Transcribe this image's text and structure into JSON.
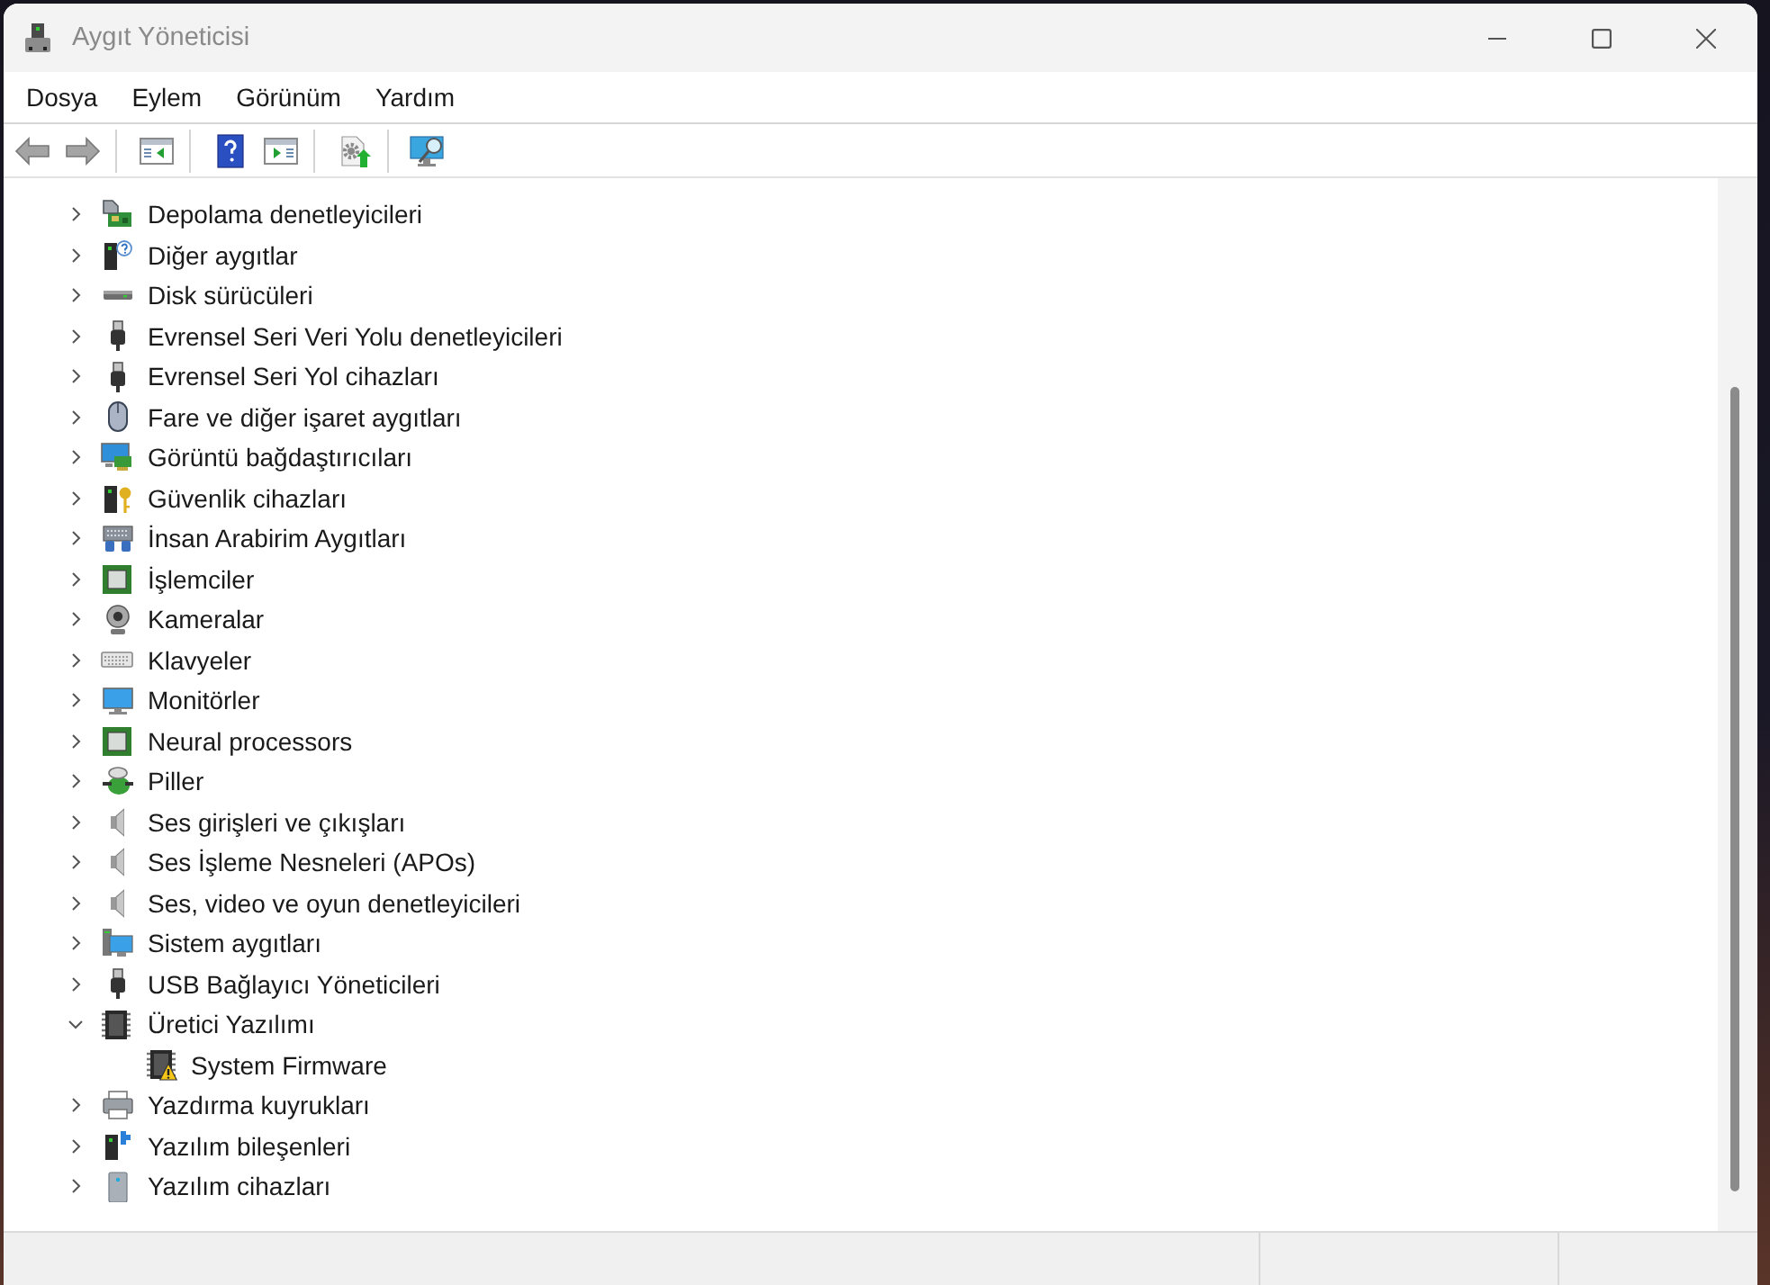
{
  "window": {
    "title": "Aygıt Yöneticisi"
  },
  "menu": [
    "Dosya",
    "Eylem",
    "Görünüm",
    "Yardım"
  ],
  "toolbar": {
    "back": {
      "disabled": true
    },
    "forward": {
      "disabled": true
    }
  },
  "tree": [
    {
      "label": "Depolama denetleyicileri",
      "kind": "storage",
      "expanded": false
    },
    {
      "label": "Diğer aygıtlar",
      "kind": "unknown",
      "expanded": false
    },
    {
      "label": "Disk sürücüleri",
      "kind": "disk",
      "expanded": false
    },
    {
      "label": "Evrensel Seri Veri Yolu denetleyicileri",
      "kind": "usb",
      "expanded": false
    },
    {
      "label": "Evrensel Seri Yol cihazları",
      "kind": "usb",
      "expanded": false
    },
    {
      "label": "Fare ve diğer işaret aygıtları",
      "kind": "mouse",
      "expanded": false
    },
    {
      "label": "Görüntü bağdaştırıcıları",
      "kind": "display",
      "expanded": false
    },
    {
      "label": "Güvenlik cihazları",
      "kind": "security",
      "expanded": false
    },
    {
      "label": "İnsan Arabirim Aygıtları",
      "kind": "hid",
      "expanded": false
    },
    {
      "label": "İşlemciler",
      "kind": "processor",
      "expanded": false
    },
    {
      "label": "Kameralar",
      "kind": "camera",
      "expanded": false
    },
    {
      "label": "Klavyeler",
      "kind": "keyboard",
      "expanded": false
    },
    {
      "label": "Monitörler",
      "kind": "monitor",
      "expanded": false
    },
    {
      "label": "Neural processors",
      "kind": "processor",
      "expanded": false
    },
    {
      "label": "Piller",
      "kind": "battery",
      "expanded": false
    },
    {
      "label": "Ses girişleri ve çıkışları",
      "kind": "audio",
      "expanded": false
    },
    {
      "label": "Ses İşleme Nesneleri (APOs)",
      "kind": "audio",
      "expanded": false
    },
    {
      "label": "Ses, video ve oyun denetleyicileri",
      "kind": "audio",
      "expanded": false
    },
    {
      "label": "Sistem aygıtları",
      "kind": "system",
      "expanded": false
    },
    {
      "label": "USB Bağlayıcı Yöneticileri",
      "kind": "usb",
      "expanded": false
    },
    {
      "label": "Üretici Yazılımı",
      "kind": "firmware",
      "expanded": true,
      "children": [
        {
          "label": "System Firmware",
          "kind": "firmware",
          "warning": true
        }
      ]
    },
    {
      "label": "Yazdırma kuyrukları",
      "kind": "printer",
      "expanded": false
    },
    {
      "label": "Yazılım bileşenleri",
      "kind": "component",
      "expanded": false
    },
    {
      "label": "Yazılım cihazları",
      "kind": "software",
      "expanded": false
    }
  ]
}
